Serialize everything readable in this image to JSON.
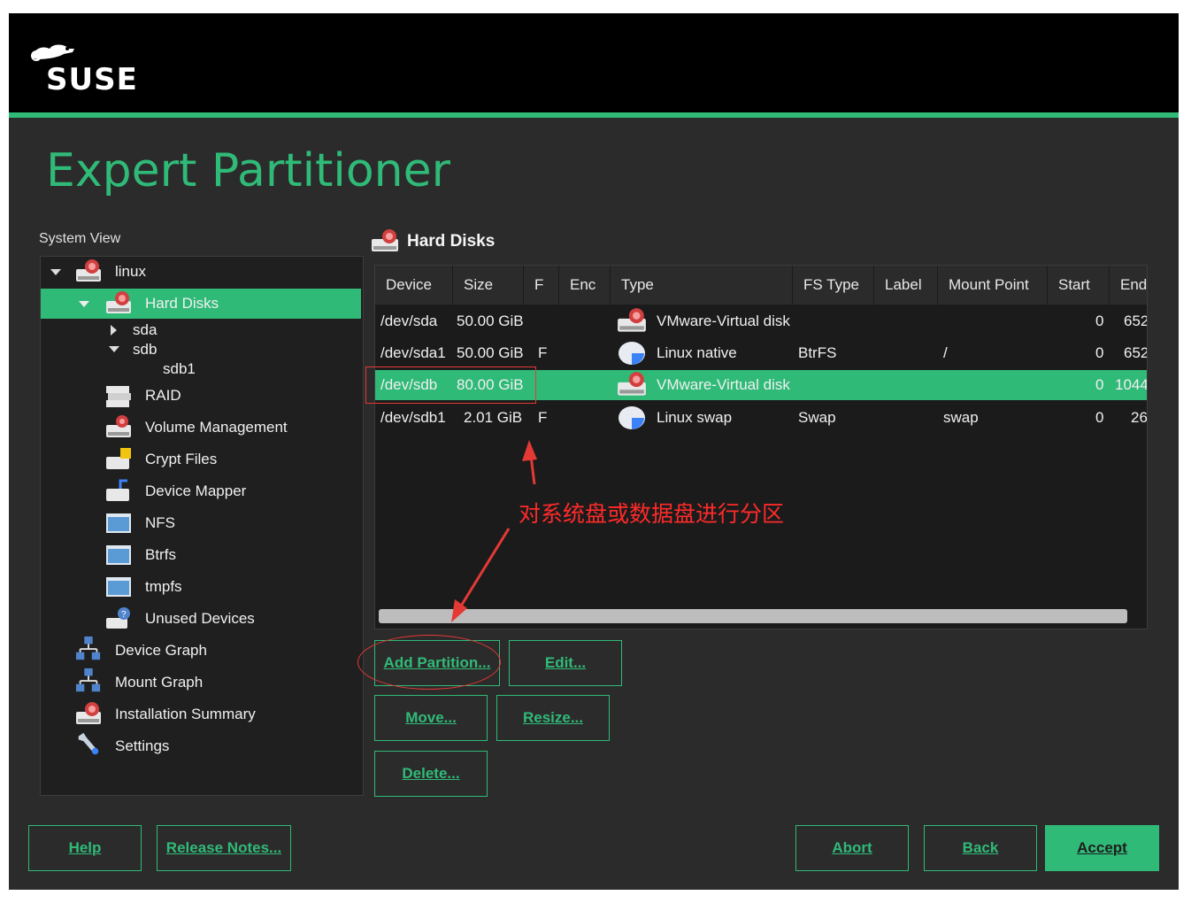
{
  "brand": {
    "logo_text": "SUSE"
  },
  "page_title": "Expert Partitioner",
  "system_view": {
    "label": "System View",
    "items": [
      {
        "label": "linux",
        "icon": "harddisk-icon"
      },
      {
        "label": "Hard Disks",
        "icon": "harddisk-icon",
        "selected": true
      },
      {
        "label": "sda"
      },
      {
        "label": "sdb"
      },
      {
        "label": "sdb1"
      },
      {
        "label": "RAID",
        "icon": "raid-icon"
      },
      {
        "label": "Volume Management",
        "icon": "volume-icon"
      },
      {
        "label": "Crypt Files",
        "icon": "crypt-icon"
      },
      {
        "label": "Device Mapper",
        "icon": "device-mapper-icon"
      },
      {
        "label": "NFS",
        "icon": "folder-icon"
      },
      {
        "label": "Btrfs",
        "icon": "folder-icon"
      },
      {
        "label": "tmpfs",
        "icon": "folder-icon"
      },
      {
        "label": "Unused Devices",
        "icon": "unused-icon"
      },
      {
        "label": "Device Graph",
        "icon": "graph-icon"
      },
      {
        "label": "Mount Graph",
        "icon": "graph-icon"
      },
      {
        "label": "Installation Summary",
        "icon": "harddisk-icon"
      },
      {
        "label": "Settings",
        "icon": "wrench-icon"
      }
    ]
  },
  "panel": {
    "title": "Hard Disks"
  },
  "table": {
    "columns": [
      "Device",
      "Size",
      "F",
      "Enc",
      "Type",
      "FS Type",
      "Label",
      "Mount Point",
      "Start",
      "End"
    ],
    "rows": [
      {
        "device": "/dev/sda",
        "size": "50.00 GiB",
        "f": "",
        "enc": "",
        "type": "VMware-Virtual disk",
        "fs_type": "",
        "label": "",
        "mount": "",
        "start": "0",
        "end": "652",
        "icon": "harddisk-icon"
      },
      {
        "device": "/dev/sda1",
        "size": "50.00 GiB",
        "f": "F",
        "enc": "",
        "type": "Linux native",
        "fs_type": "BtrFS",
        "label": "",
        "mount": "/",
        "start": "0",
        "end": "652",
        "icon": "partition-icon"
      },
      {
        "device": "/dev/sdb",
        "size": "80.00 GiB",
        "f": "",
        "enc": "",
        "type": "VMware-Virtual disk",
        "fs_type": "",
        "label": "",
        "mount": "",
        "start": "0",
        "end": "1044",
        "icon": "harddisk-icon",
        "selected": true
      },
      {
        "device": "/dev/sdb1",
        "size": "2.01 GiB",
        "f": "F",
        "enc": "",
        "type": "Linux swap",
        "fs_type": "Swap",
        "label": "",
        "mount": "swap",
        "start": "0",
        "end": "26",
        "icon": "partition-icon"
      }
    ]
  },
  "buttons": {
    "add_partition": "Add Partition...",
    "edit": "Edit...",
    "move": "Move...",
    "resize": "Resize...",
    "delete": "Delete...",
    "help": "Help",
    "release_notes": "Release Notes...",
    "abort": "Abort",
    "back": "Back",
    "accept": "Accept"
  },
  "annotation": {
    "text": "对系统盘或数据盘进行分区"
  },
  "colors": {
    "accent": "#30ba78",
    "annotation": "#e53935",
    "background": "#2b2b2b"
  }
}
